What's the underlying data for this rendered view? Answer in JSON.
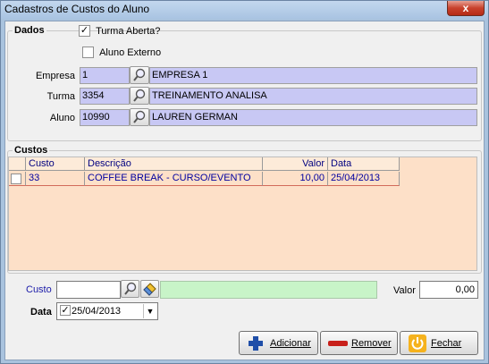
{
  "window": {
    "title": "Cadastros de Custos do Aluno",
    "close_glyph": "x"
  },
  "dados": {
    "legend": "Dados",
    "turma_aberta": {
      "label": "Turma Aberta?",
      "checked": true
    },
    "aluno_externo": {
      "label": "Aluno Externo",
      "checked": false
    },
    "empresa": {
      "label": "Empresa",
      "code": "1",
      "name": "EMPRESA 1"
    },
    "turma": {
      "label": "Turma",
      "code": "3354",
      "name": "TREINAMENTO ANALISA"
    },
    "aluno": {
      "label": "Aluno",
      "code": "10990",
      "name": "LAUREN GERMAN"
    }
  },
  "custos": {
    "legend": "Custos",
    "columns": [
      "Custo",
      "Descrição",
      "Valor",
      "Data"
    ],
    "rows": [
      {
        "checked": false,
        "custo": "33",
        "descricao": "COFFEE BREAK - CURSO/EVENTO",
        "valor": "10,00",
        "data": "25/04/2013"
      }
    ]
  },
  "form": {
    "custo_label": "Custo",
    "custo_value": "",
    "valor_label": "Valor",
    "valor_value": "0,00",
    "data_label": "Data",
    "data_value": "25/04/2013",
    "data_checked": true
  },
  "buttons": {
    "adicionar": "Adicionar",
    "remover": "Remover",
    "fechar": "Fechar"
  },
  "icons": [
    "magnifier-icon",
    "eraser-icon",
    "plus-icon",
    "minus-icon",
    "power-icon",
    "checkbox-icon",
    "dropdown-arrow-icon"
  ],
  "colors": {
    "field_bg": "#c8c8f4",
    "grid_bg": "#fde0c8",
    "custo_input_bg": "#c8f4c8",
    "accent_text": "#0000a0"
  }
}
